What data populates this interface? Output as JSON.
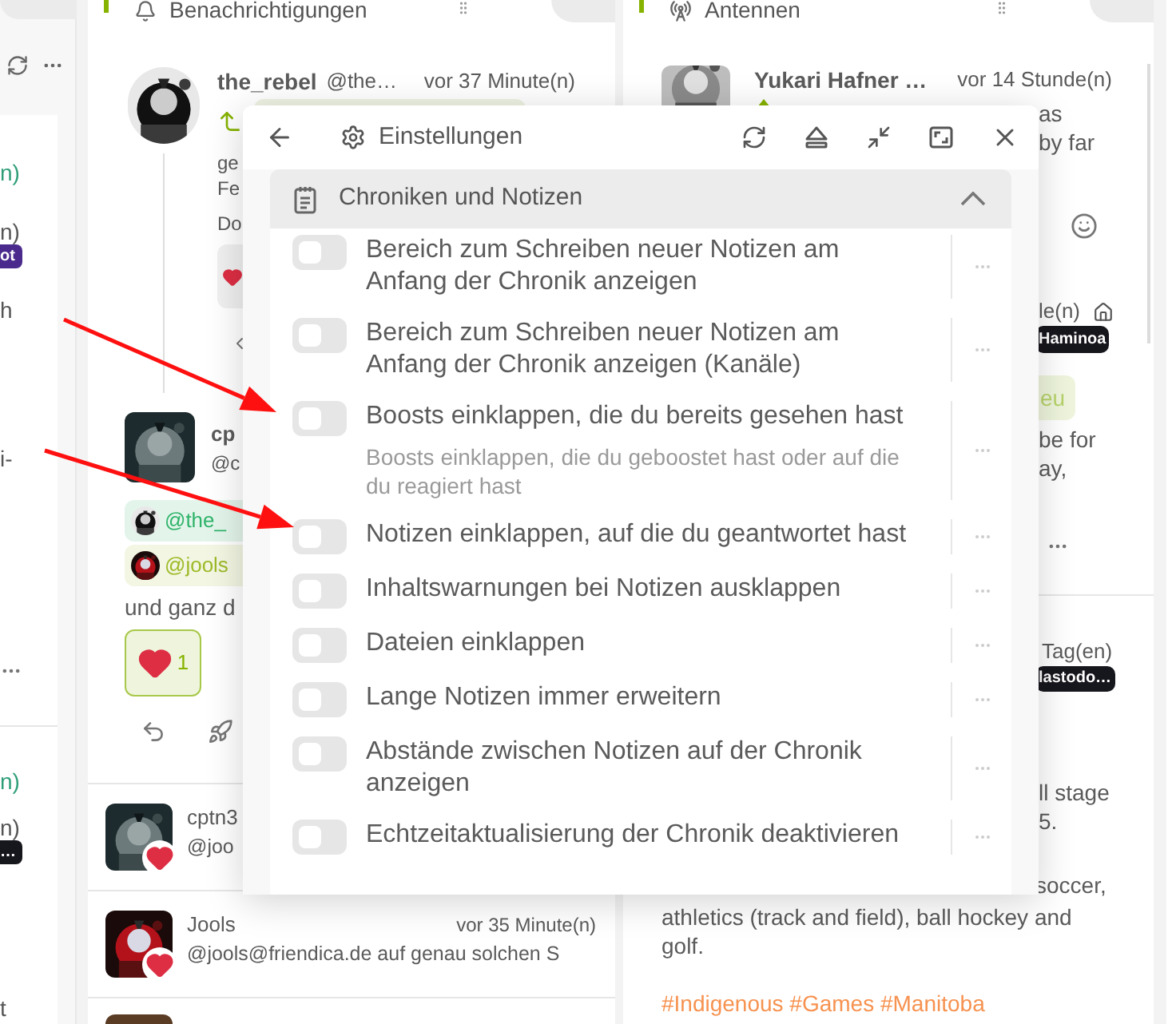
{
  "left_column": {
    "notes": [
      {
        "time": "n)",
        "time_2": "n)",
        "badge": "ot",
        "color": "#4a2a8c",
        "lines": [
          "h",
          "i-"
        ]
      },
      {
        "time": "n)",
        "time_2": "n)",
        "badge": "…",
        "color": "#16161d",
        "lines": [
          "t"
        ]
      }
    ]
  },
  "notifications_column": {
    "title": "Benachrichtigungen",
    "thread": [
      {
        "name": "the_rebel",
        "handle": "@the…",
        "time": "vor 37 Minute(n)",
        "lines": [
          "ge",
          "Fe",
          "Do"
        ]
      },
      {
        "name": "cp",
        "handle": "@c",
        "mentions": [
          {
            "text": "@the_",
            "color": "#2fb36a"
          },
          {
            "text": "@jools",
            "color": "#9dba28"
          }
        ],
        "text": "und ganz d",
        "reaction_count": "1"
      }
    ],
    "items": [
      {
        "name": "cptn3",
        "quote": "@joo"
      },
      {
        "name": "Jools",
        "time": "vor 35 Minute(n)",
        "quote": "@jools@friendica.de auf genau solchen S"
      }
    ]
  },
  "antennas_column": {
    "title": "Antennen",
    "note": {
      "name": "Yukari Hafner …",
      "time": "vor 14 Stunde(n)",
      "lines": [
        "as",
        "by far"
      ]
    },
    "renote": {
      "time": "le(n)",
      "badge": "Haminoa",
      "tag": "eu",
      "lines": [
        "be for",
        "ay,"
      ]
    },
    "next_note": {
      "time": "Tag(en)",
      "badge": "lastodo…",
      "lines": [
        "ll stage",
        "5."
      ],
      "lines_2": [
        "soccer,"
      ],
      "paragraph": [
        "athletics (track and field), ball hockey and",
        "golf."
      ],
      "hashtags": "#Indigenous #Games #Manitoba"
    }
  },
  "settings_window": {
    "title": "Einstellungen",
    "section": {
      "title": "Chroniken und Notizen",
      "expanded": true,
      "options": [
        {
          "label": "Bereich zum Schreiben neuer Notizen am Anfang der Chronik anzeigen",
          "on": false
        },
        {
          "label": "Bereich zum Schreiben neuer Notizen am Anfang der Chronik anzeigen (Kanäle)",
          "on": false
        },
        {
          "label": "Boosts einklappen, die du bereits gesehen hast",
          "on": false,
          "description": "Boosts einklappen, die du geboostet hast oder auf die du reagiert hast"
        },
        {
          "label": "Notizen einklappen, auf die du geantwortet hast",
          "on": false
        },
        {
          "label": "Inhaltswarnungen bei Notizen ausklappen",
          "on": false
        },
        {
          "label": "Dateien einklappen",
          "on": false
        },
        {
          "label": "Lange Notizen immer erweitern",
          "on": false
        },
        {
          "label": "Abstände zwischen Notizen auf der Chronik anzeigen",
          "on": false
        },
        {
          "label": "Echtzeitaktualisierung der Chronik deaktivieren",
          "on": false
        }
      ]
    }
  }
}
